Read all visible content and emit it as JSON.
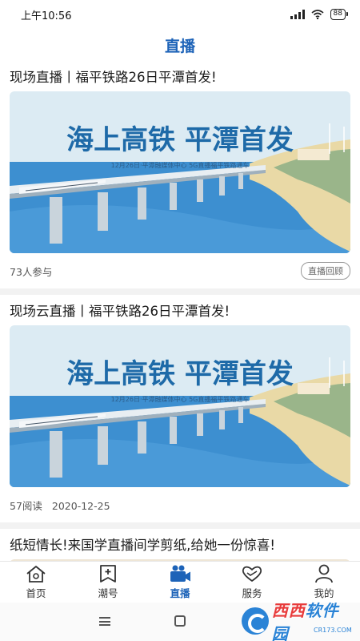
{
  "status_bar": {
    "time": "上午10:56",
    "battery": "88"
  },
  "header": {
    "title": "直播"
  },
  "feed": {
    "items": [
      {
        "title": "现场直播丨福平铁路26日平潭首发!",
        "image": {
          "headline": "海上高铁 平潭首发",
          "caption": "12月26日·平潭融媒体中心 5G直播福平铁路通车"
        },
        "stat": "73人参与",
        "tag": "直播回顾"
      },
      {
        "title": "现场云直播丨福平铁路26日平潭首发!",
        "image": {
          "headline": "海上高铁 平潭首发",
          "caption": "12月26日·平潭融媒体中心 5G直播福平铁路通车"
        },
        "stat": "57阅读",
        "date": "2020-12-25"
      },
      {
        "title": "纸短情长!来国学直播间学剪纸,给她一份惊喜!"
      }
    ]
  },
  "tabbar": {
    "tabs": [
      {
        "label": "首页",
        "icon": "home-icon"
      },
      {
        "label": "潮号",
        "icon": "subscribe-icon"
      },
      {
        "label": "直播",
        "icon": "video-camera-icon",
        "active": true
      },
      {
        "label": "服务",
        "icon": "heart-hands-icon"
      },
      {
        "label": "我的",
        "icon": "user-icon"
      }
    ]
  },
  "watermark": {
    "text_left": "西西",
    "text_right": "软件园",
    "sub": "CR173.COM"
  },
  "colors": {
    "accent": "#1d63b8",
    "sea": "#3d8fd0",
    "sky": "#dfeef6"
  }
}
